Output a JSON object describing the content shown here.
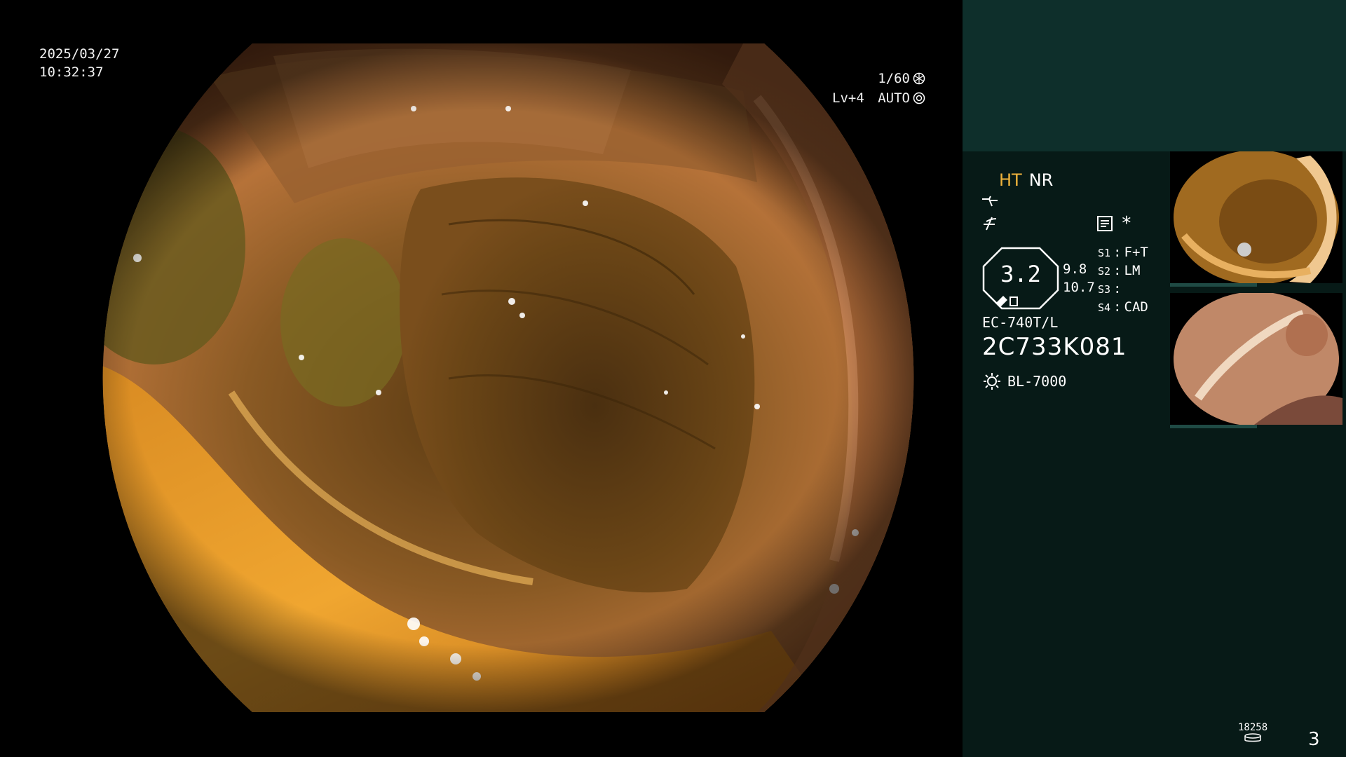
{
  "osd": {
    "date": "2025/03/27",
    "time": "10:32:37",
    "shutter": "1/60",
    "level": "Lv+4",
    "mode": "AUTO"
  },
  "panel": {
    "enhance": "HT",
    "noise_reduction": "NR",
    "zoom_value": "3.2",
    "lens_top": "9.8",
    "lens_bottom": "10.7",
    "switches": [
      {
        "key": "S1",
        "value": "F+T"
      },
      {
        "key": "S2",
        "value": "LM"
      },
      {
        "key": "S3",
        "value": ""
      },
      {
        "key": "S4",
        "value": "CAD"
      }
    ],
    "scope_model": "EC-740T/L",
    "scope_serial": "2C733K081",
    "light_source": "BL-7000",
    "image_count": "18258",
    "page_number": "3",
    "star_symbol": "*"
  },
  "colors": {
    "accent_ht": "#f0b43c",
    "panel_bg": "#071a17",
    "panel_top": "#0e2f2b"
  },
  "icons": {
    "shutter": "aperture-icon",
    "auto": "iris-icon",
    "structure": "structure-enhance-icon",
    "color": "color-enhance-icon",
    "memo": "memo-icon",
    "light": "light-source-icon",
    "storage": "storage-icon"
  }
}
